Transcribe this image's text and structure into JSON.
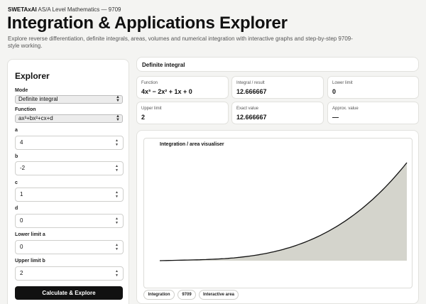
{
  "brand": {
    "name": "SWETAxAI",
    "tagline": "AS/A Level Mathematics — 9709"
  },
  "page": {
    "title": "Integration & Applications Explorer",
    "subtitle": "Explore reverse differentiation, definite integrals, areas, volumes and numerical integration with interactive graphs and step-by-step 9709-style working."
  },
  "explorer": {
    "heading": "Explorer",
    "mode_label": "Mode",
    "mode_value": "Definite integral",
    "function_label": "Function",
    "function_value": "ax³+bx²+cx+d",
    "fields": [
      {
        "label": "a",
        "value": "4"
      },
      {
        "label": "b",
        "value": "-2"
      },
      {
        "label": "c",
        "value": "1"
      },
      {
        "label": "d",
        "value": "0"
      },
      {
        "label": "Lower limit a",
        "value": "0"
      },
      {
        "label": "Upper limit b",
        "value": "2"
      }
    ],
    "button_label": "Calculate & Explore"
  },
  "results": {
    "heading": "Definite integral",
    "cards": [
      {
        "label": "Function",
        "value": "4x³ − 2x² + 1x + 0"
      },
      {
        "label": "Integral / result",
        "value": "12.666667"
      },
      {
        "label": "Lower limit",
        "value": "0"
      },
      {
        "label": "Upper limit",
        "value": "2"
      },
      {
        "label": "Exact value",
        "value": "12.666667"
      },
      {
        "label": "Approx. value",
        "value": "—"
      }
    ]
  },
  "graph": {
    "title": "Integration / area visualiser",
    "curve_color": "#111111",
    "fill_color": "#d4d4cc"
  },
  "chart_data": {
    "type": "area",
    "title": "Integration / area visualiser",
    "function": {
      "a": 4,
      "b": -2,
      "c": 1,
      "d": 0
    },
    "x_range": [
      0,
      2
    ],
    "grid": false
  },
  "chips": [
    "Integration",
    "9709",
    "Interactive area"
  ]
}
